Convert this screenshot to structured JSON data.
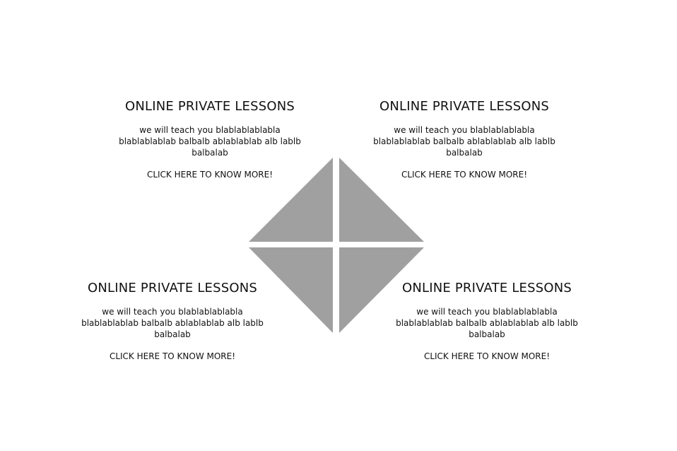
{
  "cards": [
    {
      "title": "ONLINE PRIVATE LESSONS",
      "body": "we will teach you blablablablabla blablablablab balbalb ablablablab alb lablb balbalab",
      "cta": "CLICK HERE TO KNOW MORE!"
    },
    {
      "title": "ONLINE PRIVATE LESSONS",
      "body": "we will teach you blablablablabla blablablablab balbalb ablablablab alb lablb balbalab",
      "cta": "CLICK HERE TO KNOW MORE!"
    },
    {
      "title": "ONLINE PRIVATE LESSONS",
      "body": "we will teach you blablablablabla blablablablab balbalb ablablablab alb lablb balbalab",
      "cta": "CLICK HERE TO KNOW MORE!"
    },
    {
      "title": "ONLINE PRIVATE LESSONS",
      "body": "we will teach you blablablablabla blablablablab balbalb ablablablab alb lablb balbalab",
      "cta": "CLICK HERE TO KNOW MORE!"
    }
  ],
  "colors": {
    "background": "#ffffff",
    "text": "#111111",
    "diamond_fill": "#a0a0a0"
  }
}
